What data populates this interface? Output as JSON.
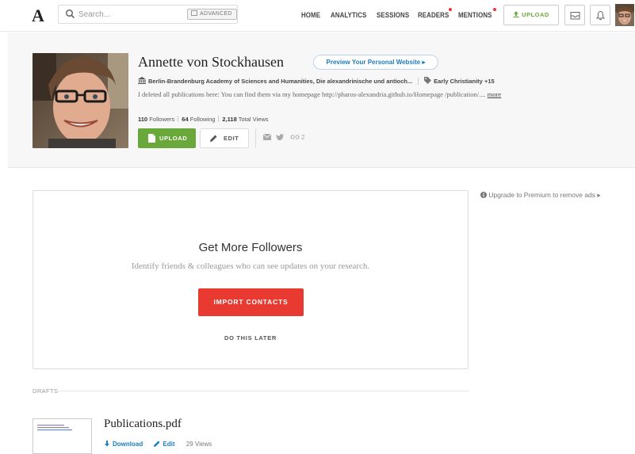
{
  "nav": {
    "logo": "A",
    "search_placeholder": "Search...",
    "advanced_label": "ADVANCED",
    "links": [
      {
        "label": "HOME",
        "dot": false
      },
      {
        "label": "ANALYTICS",
        "dot": false
      },
      {
        "label": "SESSIONS",
        "dot": false
      },
      {
        "label": "READERS",
        "dot": true
      },
      {
        "label": "MENTIONS",
        "dot": true
      }
    ],
    "upload_label": "UPLOAD",
    "upload_icon": "upload-icon",
    "inbox_icon": "inbox-icon",
    "bell_icon": "bell-icon"
  },
  "profile": {
    "name": "Annette von Stockhausen",
    "preview_label": "Preview Your Personal Website ▸",
    "affiliation": "Berlin-Brandenburg Academy of Sciences and Humanities, Die alexandrinische und antioch...",
    "interest": "Early Christianity",
    "interest_more": "+15",
    "bio": "I deleted all publications here: You can find them via my homepage http://pharos-alexandria.github.io/Homepage /publication/....",
    "bio_more": "more",
    "followers_count": "110",
    "followers_label": "Followers",
    "following_count": "64",
    "following_label": "Following",
    "views_count": "2,118",
    "views_label": "Total Views",
    "upload_label": "UPLOAD",
    "edit_label": "EDIT",
    "link_count": "2"
  },
  "card": {
    "title": "Get More Followers",
    "subtitle": "Identify friends & colleagues who can see updates on your research.",
    "import_label": "IMPORT CONTACTS",
    "later_label": "DO THIS LATER"
  },
  "premium_text": "Upgrade to Premium to remove ads ▸",
  "drafts": {
    "label": "DRAFTS",
    "items": [
      {
        "title": "Publications.pdf",
        "download_label": "Download",
        "edit_label": "Edit",
        "views": "29 Views"
      }
    ]
  },
  "colors": {
    "green": "#6aa83b",
    "red": "#e83a30",
    "blue_link": "#1b7cc1",
    "notification_dot": "#e53935"
  }
}
